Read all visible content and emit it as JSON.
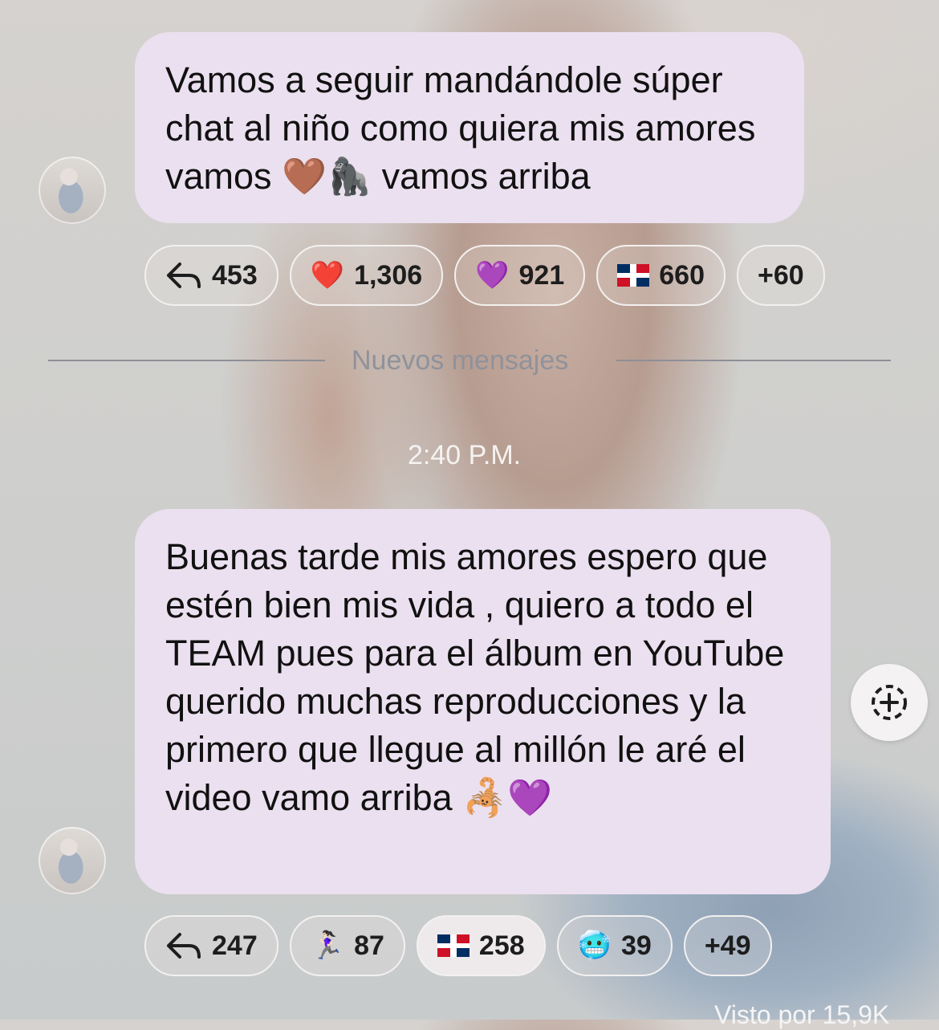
{
  "messages": [
    {
      "text": "Vamos a seguir mandándole súper chat al niño como quiera mis amores vamos 🤎🦍 vamos arriba",
      "reactions": {
        "replies": "453",
        "items": [
          {
            "emoji": "❤️",
            "count": "1,306"
          },
          {
            "emoji": "💜",
            "count": "921"
          },
          {
            "emoji": "flag-dominican-republic",
            "count": "660"
          }
        ],
        "more": "+60"
      }
    },
    {
      "text": "Buenas tarde mis amores espero que estén bien mis vida , quiero a todo el TEAM pues para el álbum en YouTube querido muchas reproducciones y la primero que llegue al millón le aré el video vamo arriba 🦂💜",
      "reactions": {
        "replies": "247",
        "items": [
          {
            "emoji": "🏃🏻‍♀️",
            "count": "87"
          },
          {
            "emoji": "flag-dominican-republic",
            "count": "258"
          },
          {
            "emoji": "🥶",
            "count": "39"
          }
        ],
        "more": "+49"
      }
    }
  ],
  "divider_label": "Nuevos mensajes",
  "timestamp": "2:40 P.M.",
  "views_label": "Visto por 15,9K",
  "icons": {
    "reply": "reply-arrow-icon",
    "add_reaction": "add-reaction-icon",
    "avatar": "user-avatar"
  },
  "colors": {
    "bubble": "#ebe0ef",
    "pill_border": "#f3f1f0",
    "divider": "#8e8f97"
  }
}
